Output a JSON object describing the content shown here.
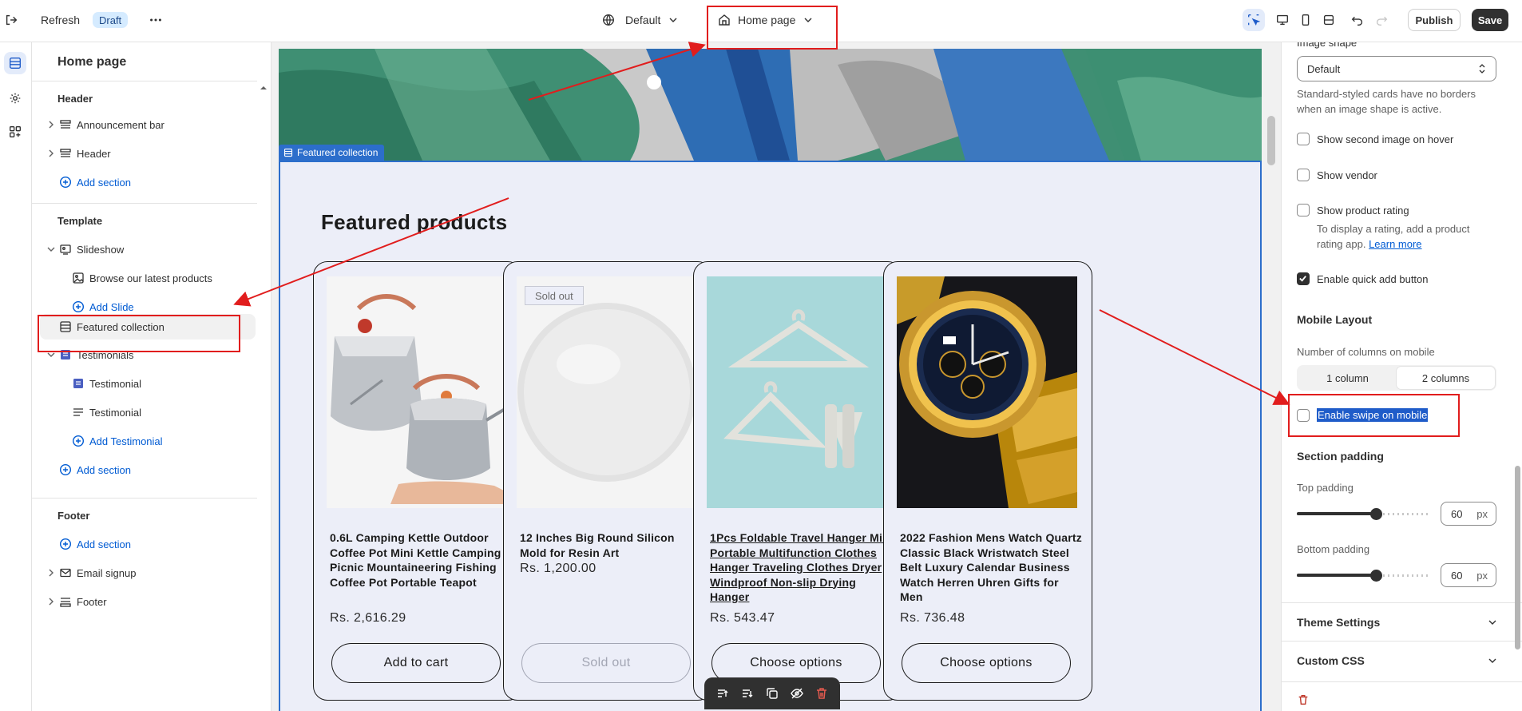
{
  "topbar": {
    "refresh_label": "Refresh",
    "draft_label": "Draft",
    "theme_label": "Default",
    "page_label": "Home page",
    "publish_label": "Publish",
    "save_label": "Save"
  },
  "left_panel": {
    "title": "Home page",
    "header_group": "Header",
    "header_items": [
      "Announcement bar",
      "Header"
    ],
    "add_section": "Add section",
    "template_group": "Template",
    "slideshow": "Slideshow",
    "slide_item": "Browse our latest products",
    "add_slide": "Add Slide",
    "featured_collection": "Featured collection",
    "testimonials": "Testimonials",
    "testimonial_items": [
      "Testimonial",
      "Testimonial"
    ],
    "add_testimonial": "Add Testimonial",
    "footer_group": "Footer",
    "footer_items": [
      "Email signup",
      "Footer"
    ]
  },
  "preview": {
    "section_label": "Featured collection",
    "section_title": "Featured products",
    "products": [
      {
        "title": "0.6L Camping Kettle Outdoor Coffee Pot Mini Kettle Camping Picnic Mountaineering Fishing Coffee Pot Portable Teapot",
        "price": "Rs. 2,616.29",
        "button": "Add to cart"
      },
      {
        "title": "12 Inches Big Round Silicon Mold for Resin Art",
        "price": "Rs. 1,200.00",
        "button": "Sold out",
        "badge": "Sold out"
      },
      {
        "title": "1Pcs Foldable Travel Hanger Mini Portable Multifunction Clothes Hanger Traveling Clothes Dryer Windproof Non-slip Drying Hanger",
        "price": "Rs. 543.47",
        "button": "Choose options"
      },
      {
        "title": "2022 Fashion Mens Watch Quartz Classic Black Wristwatch Steel Belt Luxury Calendar Business Watch Herren Uhren Gifts for Men",
        "price": "Rs. 736.48",
        "button": "Choose options"
      }
    ]
  },
  "right_panel": {
    "image_shape_label": "Image shape",
    "image_shape_value": "Default",
    "image_shape_help": "Standard-styled cards have no borders when an image shape is active.",
    "show_second_image": "Show second image on hover",
    "show_vendor": "Show vendor",
    "show_rating": "Show product rating",
    "rating_help": "To display a rating, add a product rating app.",
    "learn_more": "Learn more",
    "quick_add": "Enable quick add button",
    "mobile_layout": "Mobile Layout",
    "columns_label": "Number of columns on mobile",
    "col_one": "1 column",
    "col_two": "2 columns",
    "swipe_label": "Enable swipe on mobile",
    "section_padding": "Section padding",
    "top_padding": "Top padding",
    "top_value": "60",
    "bottom_padding": "Bottom padding",
    "bottom_value": "60",
    "unit": "px",
    "theme_settings": "Theme Settings",
    "custom_css": "Custom CSS",
    "padding_fraction": 0.6
  },
  "colors": {
    "accent": "#2c6ecb",
    "annotation": "#e11d1d",
    "link": "#005bd3"
  }
}
